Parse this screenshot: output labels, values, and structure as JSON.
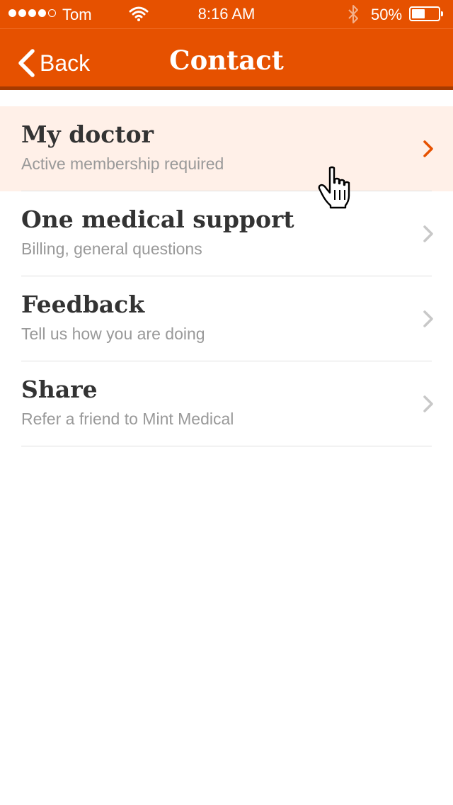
{
  "status_bar": {
    "carrier": "Tom",
    "time": "8:16 AM",
    "battery": "50%",
    "signal_bars_filled": 4,
    "signal_bars_total": 5,
    "battery_level": 0.5,
    "icons": [
      "signal-dots-icon",
      "wifi-icon",
      "bluetooth-icon",
      "battery-icon"
    ]
  },
  "nav": {
    "back_label": "Back",
    "title": "Contact"
  },
  "list": {
    "items": [
      {
        "title": "My doctor",
        "subtitle": "Active membership required",
        "highlighted": true
      },
      {
        "title": "One medical support",
        "subtitle": "Billing, general questions",
        "highlighted": false
      },
      {
        "title": "Feedback",
        "subtitle": "Tell us how you are doing",
        "highlighted": false
      },
      {
        "title": "Share",
        "subtitle": "Refer a friend to Mint  Medical",
        "highlighted": false
      }
    ]
  },
  "colors": {
    "brand_orange": "#e65100",
    "nav_shadow": "#a63a00",
    "highlight_bg": "#fff0e8",
    "title_text": "#333333",
    "subtitle_text": "#999999",
    "chevron_active": "#e65100",
    "chevron_inactive": "#c8c8c8"
  }
}
